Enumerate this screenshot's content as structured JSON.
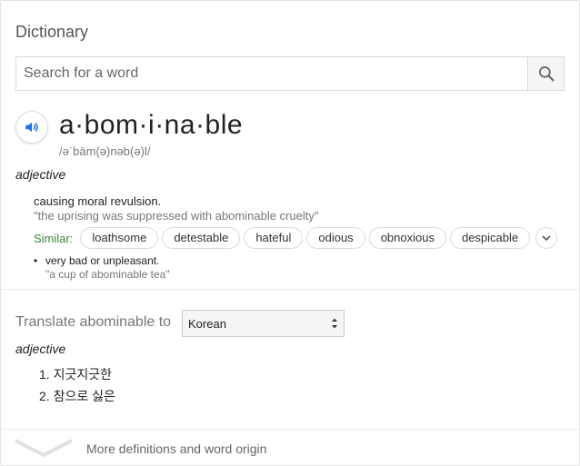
{
  "header": {
    "title": "Dictionary"
  },
  "search": {
    "placeholder": "Search for a word",
    "value": ""
  },
  "entry": {
    "word": "a·bom·i·na·ble",
    "phonetic": "/əˈbäm(ə)nəb(ə)l/",
    "part_of_speech": "adjective",
    "sense1": {
      "definition": "causing moral revulsion.",
      "example": "\"the uprising was suppressed with abominable cruelty\"",
      "similar_label": "Similar:",
      "similar": [
        "loathsome",
        "detestable",
        "hateful",
        "odious",
        "obnoxious",
        "despicable"
      ]
    },
    "sense2": {
      "bullet": "•",
      "definition": "very bad or unpleasant.",
      "example": "\"a cup of abominable tea\""
    }
  },
  "translate": {
    "label": "Translate abominable to",
    "language": "Korean",
    "part_of_speech": "adjective",
    "items": [
      "1. 지긋지긋한",
      "2. 참으로 싫은"
    ]
  },
  "footer": {
    "more_label": "More definitions and word origin"
  },
  "icons": {
    "speaker": "speaker-icon",
    "search": "search-icon",
    "expand": "chevron-down-icon",
    "select_arrows": "updown-arrows-icon"
  },
  "colors": {
    "accent_blue": "#1a73e8",
    "similar_green": "#3c8a3c"
  }
}
